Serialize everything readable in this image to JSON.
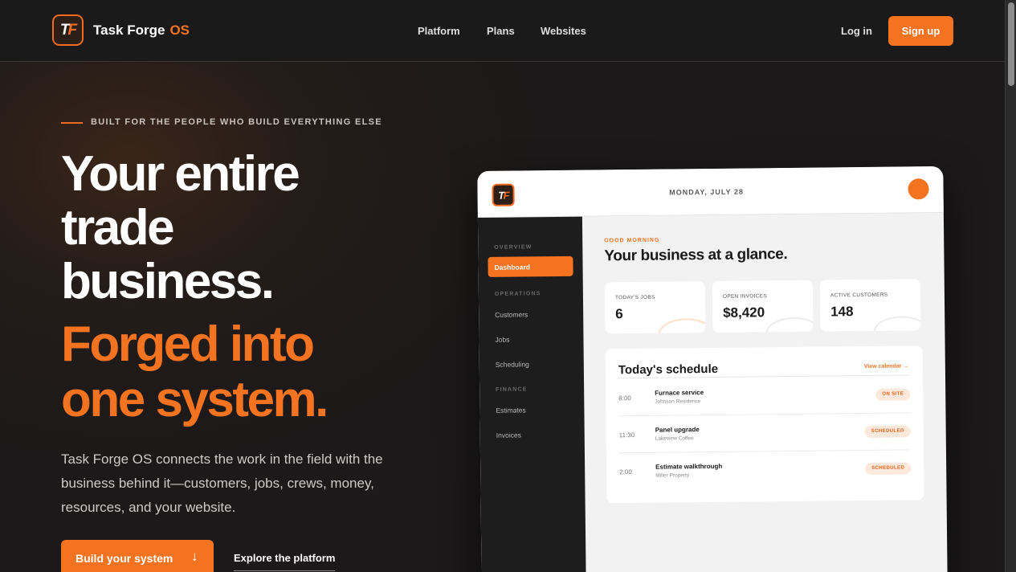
{
  "header": {
    "logo_text": "TF",
    "brand_name": "Task Forge",
    "brand_suffix": "OS",
    "nav": [
      "Platform",
      "Plans",
      "Websites"
    ],
    "login_label": "Log in",
    "signup_label": "Sign up"
  },
  "hero": {
    "eyebrow": "BUILT FOR THE PEOPLE WHO BUILD EVERYTHING ELSE",
    "headline_lines": [
      "Your entire",
      "trade",
      "business."
    ],
    "accent_lines": [
      "Forged into",
      "one system."
    ],
    "lede": "Task Forge OS connects the work in the field with the business behind it—customers, jobs, crews, money, resources, and your website.",
    "primary_cta": "Build your system",
    "primary_cta_icon": "↓",
    "secondary_cta": "Explore the platform"
  },
  "mockup": {
    "logo_text": "TF",
    "date": "MONDAY, JULY 28",
    "sidebar": {
      "groups": [
        {
          "label": "OVERVIEW",
          "items": [
            "Dashboard"
          ]
        },
        {
          "label": "OPERATIONS",
          "items": [
            "Customers",
            "Jobs",
            "Scheduling"
          ]
        },
        {
          "label": "FINANCE",
          "items": [
            "Estimates",
            "Invoices"
          ]
        }
      ],
      "active": "Dashboard"
    },
    "greeting": "GOOD MORNING",
    "title": "Your business at a glance.",
    "stats": [
      {
        "label": "TODAY'S JOBS",
        "value": "6"
      },
      {
        "label": "OPEN INVOICES",
        "value": "$8,420"
      },
      {
        "label": "ACTIVE CUSTOMERS",
        "value": "148"
      }
    ],
    "schedule": {
      "title": "Today's schedule",
      "link": "View calendar →",
      "rows": [
        {
          "time": "8:00",
          "title": "Furnace service",
          "sub": "Johnson Residence",
          "status": "ON SITE"
        },
        {
          "time": "11:30",
          "title": "Panel upgrade",
          "sub": "Lakeview Coffee",
          "status": "SCHEDULED"
        },
        {
          "time": "2:00",
          "title": "Estimate walkthrough",
          "sub": "Miller Property",
          "status": "SCHEDULED"
        }
      ]
    }
  },
  "colors": {
    "accent": "#f47320",
    "background": "#1b1919",
    "text": "#ffffff"
  }
}
